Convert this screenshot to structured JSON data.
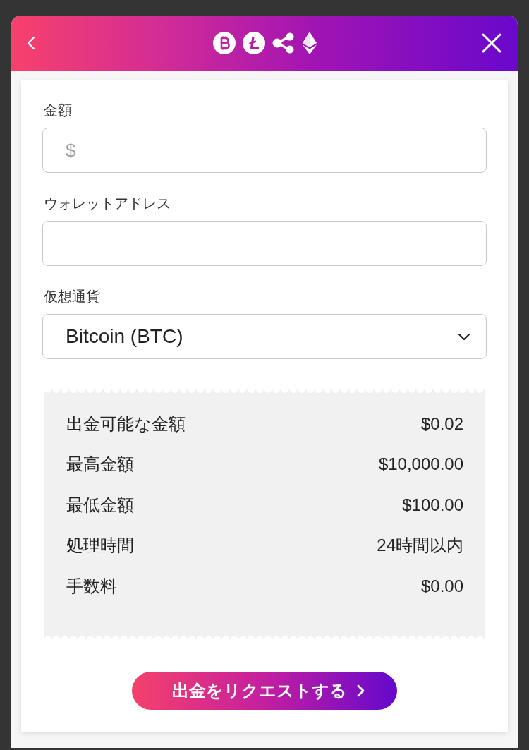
{
  "form": {
    "fields": [
      {
        "kind": "amount",
        "label": "金額",
        "placeholder": "$"
      },
      {
        "kind": "text",
        "label": "ウォレットアドレス"
      },
      {
        "kind": "select",
        "label": "仮想通貨",
        "value": "Bitcoin (BTC)"
      }
    ]
  },
  "summary": {
    "rows": [
      {
        "label": "出金可能な金額",
        "value": "$0.02"
      },
      {
        "label": "最高金額",
        "value": "$10,000.00"
      },
      {
        "label": "最低金額",
        "value": "$100.00"
      },
      {
        "label": "処理時間",
        "value": "24時間以内"
      },
      {
        "label": "手数料",
        "value": "$0.00"
      }
    ]
  },
  "submit_button": {
    "label": "出金をリクエストする"
  }
}
